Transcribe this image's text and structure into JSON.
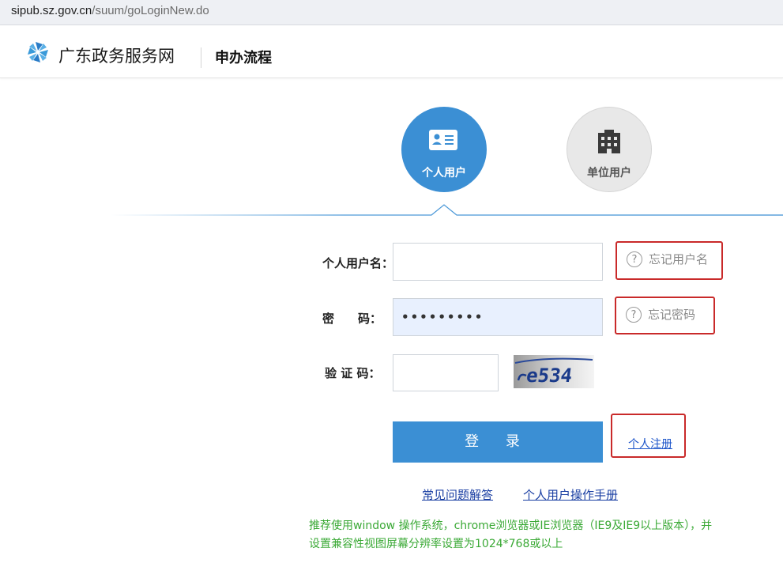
{
  "browser": {
    "url_host": "sipub.sz.gov.cn",
    "url_path": "/suum/goLoginNew.do"
  },
  "header": {
    "brand": "广东政务服务网",
    "title": "申办流程",
    "logo_icon": "pinwheel-logo-icon"
  },
  "tabs": [
    {
      "label": "个人用户",
      "icon": "id-card-icon",
      "active": true
    },
    {
      "label": "单位用户",
      "icon": "building-icon",
      "active": false
    }
  ],
  "form": {
    "username_label": "个人用户名：",
    "username_value": "",
    "password_label": "密　　码：",
    "password_value": "•••••••••",
    "captcha_label": "验 证 码：",
    "captcha_value": "",
    "captcha_text": "e534",
    "forgot_username": "忘记用户名",
    "forgot_password": "忘记密码",
    "help_icon": "question-circle-icon",
    "login_button": "登 录",
    "register_link": "个人注册"
  },
  "links": {
    "faq": "常见问题解答",
    "manual": "个人用户操作手册"
  },
  "note": {
    "line1": "推荐使用window 操作系统，chrome浏览器或IE浏览器（IE9及IE9以上版本），并",
    "line2": "设置兼容性视图屏幕分辨率设置为1024*768或以上"
  },
  "colors": {
    "primary_blue": "#3b8fd4",
    "highlight_red": "#c92a2a",
    "note_green": "#3aa935",
    "link_blue": "#1a3fa3"
  }
}
